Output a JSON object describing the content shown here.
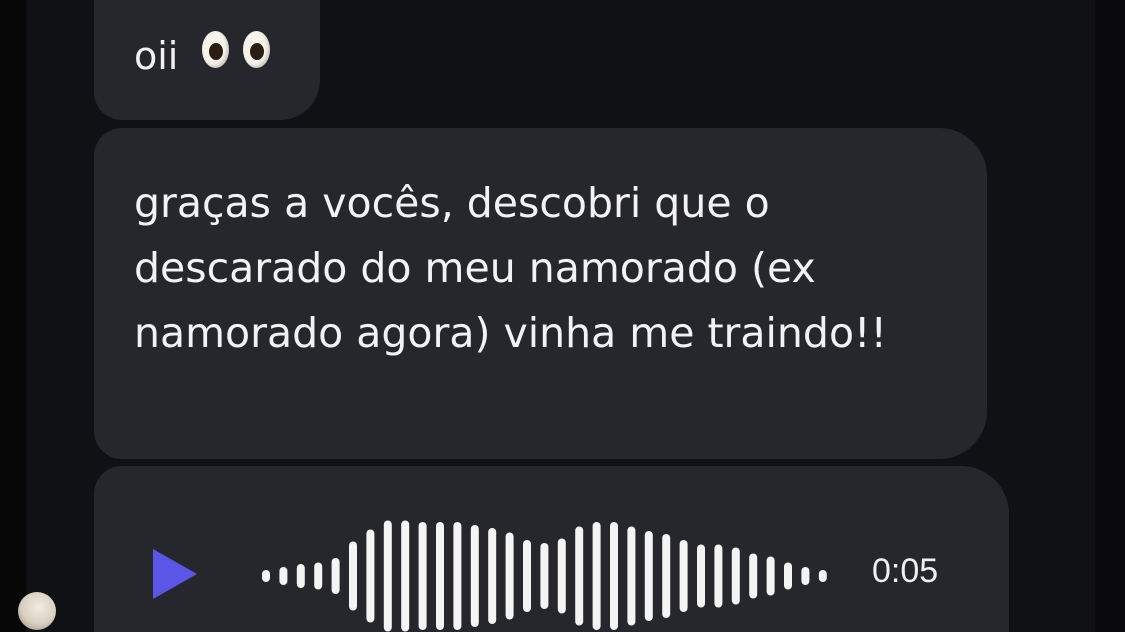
{
  "messages": [
    {
      "text": "oii",
      "emoji": "eyes"
    },
    {
      "text": "graças a vocês, descobri que o descarado do meu namorado (ex namorado agora) vinha me traindo!!"
    },
    {
      "type": "voice",
      "duration": "0:05",
      "play_icon": "play-icon",
      "accent_color": "#5b55e8"
    }
  ],
  "colors": {
    "background": "#101114",
    "bubble": "#26272d",
    "text": "#f2f2f2",
    "play": "#5b55e8"
  },
  "waveform_levels": [
    0.08,
    0.12,
    0.16,
    0.18,
    0.24,
    0.46,
    0.62,
    0.74,
    0.74,
    0.72,
    0.72,
    0.72,
    0.68,
    0.64,
    0.58,
    0.48,
    0.44,
    0.5,
    0.66,
    0.72,
    0.72,
    0.66,
    0.6,
    0.56,
    0.48,
    0.42,
    0.42,
    0.38,
    0.3,
    0.26,
    0.18,
    0.12,
    0.08
  ]
}
